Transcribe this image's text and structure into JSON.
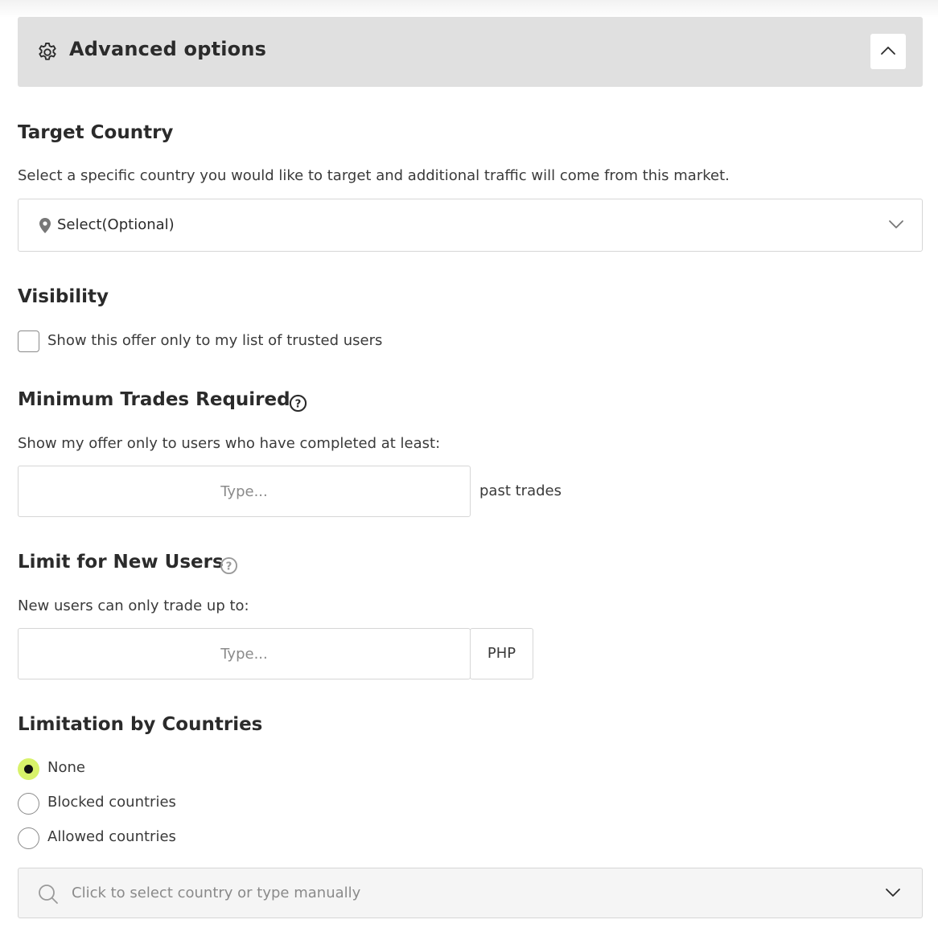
{
  "advanced": {
    "title": "Advanced options",
    "icon": "gear-icon",
    "toggle_icon": "chevron-up-icon"
  },
  "target_country": {
    "title": "Target Country",
    "description": "Select a specific country you would like to target and additional traffic will come from this market.",
    "select_value": "Select(Optional)"
  },
  "visibility": {
    "title": "Visibility",
    "checkbox_label": "Show this offer only to my list of trusted users",
    "checked": false
  },
  "min_trades": {
    "title": "Minimum Trades Required",
    "description": "Show my offer only to users who have completed at least:",
    "input_placeholder": "Type...",
    "suffix": "past trades"
  },
  "new_users": {
    "title": "Limit for New Users",
    "description": "New users can only trade up to:",
    "input_placeholder": "Type...",
    "currency": "PHP"
  },
  "countries": {
    "title": "Limitation by Countries",
    "options": [
      {
        "label": "None",
        "selected": true
      },
      {
        "label": "Blocked countries",
        "selected": false
      },
      {
        "label": "Allowed countries",
        "selected": false
      }
    ],
    "search_placeholder": "Click to select country or type manually"
  },
  "colors": {
    "header_bg": "#e0e0e0",
    "radio_selected": "#d8f26a",
    "text": "#2b2b2b",
    "border": "#d6d6d6"
  }
}
